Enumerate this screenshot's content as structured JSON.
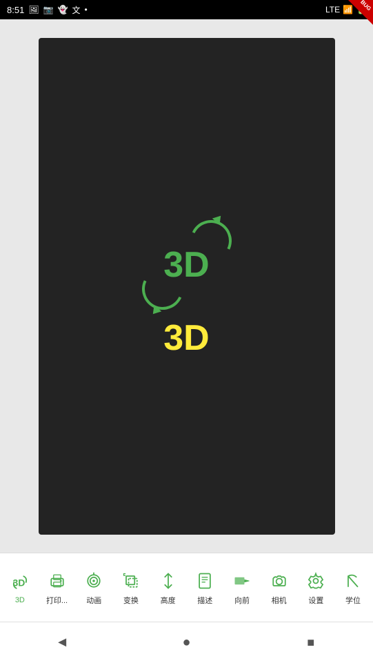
{
  "statusBar": {
    "time": "8:51",
    "icons": [
      "photo",
      "photo2",
      "snapchat",
      "translate",
      "dot"
    ],
    "rightIcons": [
      "LTE",
      "signal",
      "battery"
    ]
  },
  "debugBadge": "BUG",
  "toolbar": {
    "items": [
      {
        "id": "3d",
        "label": "3D",
        "active": true
      },
      {
        "id": "print",
        "label": "打印...",
        "active": false
      },
      {
        "id": "animate",
        "label": "动画",
        "active": false
      },
      {
        "id": "transform",
        "label": "变换",
        "active": false
      },
      {
        "id": "height",
        "label": "高度",
        "active": false
      },
      {
        "id": "describe",
        "label": "描述",
        "active": false
      },
      {
        "id": "forward",
        "label": "向前",
        "active": false
      },
      {
        "id": "camera",
        "label": "相机",
        "active": false
      },
      {
        "id": "settings",
        "label": "设置",
        "active": false
      },
      {
        "id": "degree",
        "label": "学位",
        "active": false
      }
    ]
  },
  "navBar": {
    "back": "◄",
    "home": "●",
    "recent": "■"
  },
  "canvas": {
    "text3dGreen": "3D",
    "text3dYellow": "3D"
  }
}
